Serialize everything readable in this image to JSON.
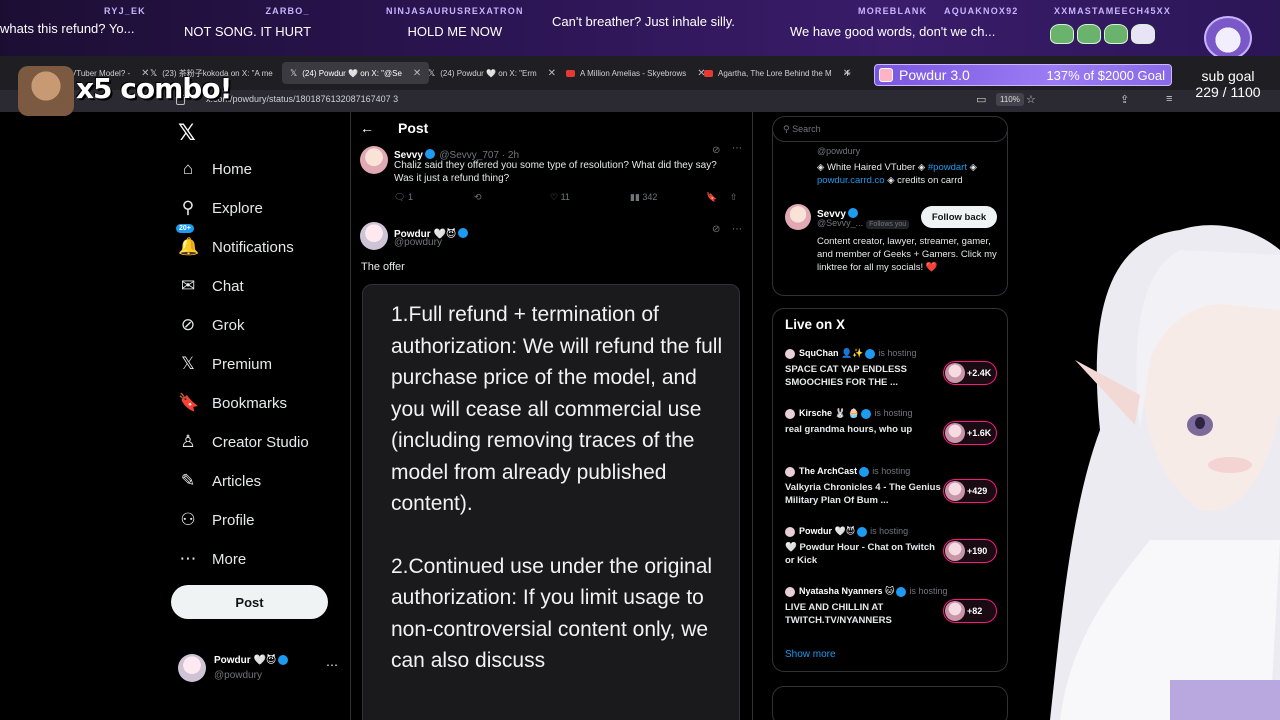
{
  "ticker": [
    {
      "user": "",
      "msg": "whats this refund? Yo..."
    },
    {
      "user": "RYJ_EK",
      "msg": ""
    },
    {
      "user": "ZARBO_",
      "msg": "NOT SONG. IT HURT"
    },
    {
      "user": "NINJASAURUSREXATRON",
      "msg": "HOLD ME NOW"
    },
    {
      "user": "",
      "msg": "Can't breather? Just inhale silly."
    },
    {
      "user": "MOREBLANK",
      "msg": "We have good words, don't we ch..."
    },
    {
      "user": "AQUAKNOX92",
      "msg": ""
    },
    {
      "user": "XXMASTAMEECH45XX",
      "msg": ""
    }
  ],
  "combo": "x5 combo!",
  "donation": {
    "name": "Powdur 3.0",
    "progress": "137% of $2000 Goal",
    "percent": 137
  },
  "subgoal": {
    "title": "sub goal",
    "value": "229 / 1100"
  },
  "browser": {
    "tabs": [
      {
        "label": "My VTuber Model? -"
      },
      {
        "label": "(23) 茶粉子kokoda on X: \"A me"
      },
      {
        "label": "(24) Powdur 🤍 on X: \"@Se"
      },
      {
        "label": "(24) Powdur 🤍 on X: \"Erm"
      },
      {
        "label": "A Million Amelias - Skyebrows"
      },
      {
        "label": "Agartha, The Lore Behind the M"
      }
    ],
    "new_tab": "+",
    "url": "x.com/powdury/status/1801876132087167407 3",
    "zoom": "110%"
  },
  "nav": {
    "items": [
      {
        "label": "Home",
        "icon": "home-icon",
        "glyph": "⌂"
      },
      {
        "label": "Explore",
        "icon": "search-icon",
        "glyph": "⚲"
      },
      {
        "label": "Notifications",
        "icon": "bell-icon",
        "glyph": "🔔",
        "badge": "20+"
      },
      {
        "label": "Chat",
        "icon": "mail-icon",
        "glyph": "✉"
      },
      {
        "label": "Grok",
        "icon": "grok-icon",
        "glyph": "⊘"
      },
      {
        "label": "Premium",
        "icon": "x-premium-icon",
        "glyph": "𝕏"
      },
      {
        "label": "Bookmarks",
        "icon": "bookmark-icon",
        "glyph": "🔖"
      },
      {
        "label": "Creator Studio",
        "icon": "creator-studio-icon",
        "glyph": "♙"
      },
      {
        "label": "Articles",
        "icon": "articles-icon",
        "glyph": "✎"
      },
      {
        "label": "Profile",
        "icon": "profile-icon",
        "glyph": "⚇"
      },
      {
        "label": "More",
        "icon": "more-icon",
        "glyph": "⋯"
      }
    ],
    "post_button": "Post",
    "account": {
      "name": "Powdur 🤍😈",
      "handle": "@powdury"
    }
  },
  "main": {
    "title": "Post",
    "reply": {
      "name": "Sevvy",
      "handle": "@Sevvy_707 · 2h",
      "text": "Chaliz said they offered you some type of resolution? What did they say? Was it just a refund thing?",
      "replies": "1",
      "likes": "11",
      "views": "342"
    },
    "op": {
      "name": "Powdur 🤍😈",
      "handle": "@powdury",
      "text": "The offer"
    },
    "image_text": [
      "1.Full refund + termination of authorization: We will refund the full purchase price of the model, and you will cease all commercial use (including removing traces of the model from     already published content).",
      "2.Continued use under the original authorization: If you limit usage to non-controversial content only, we can also discuss"
    ]
  },
  "right": {
    "search_placeholder": "Search",
    "who": {
      "handle1": "@powdury",
      "bio1_prefix": "◈ White Haired VTuber ◈ ",
      "bio1_tag": "#powdart",
      "bio1_mid": " ◈ ",
      "bio1_link": "powdur.carrd.co",
      "bio1_suffix": " ◈ credits on carrd",
      "name2": "Sevvy",
      "handle2": "@Sevvy_...",
      "follows_you": "Follows you",
      "follow_back": "Follow back",
      "bio2": "Content creator, lawyer, streamer, gamer, and member of Geeks + Gamers. Click my linktree for all my socials! ❤️"
    },
    "live": {
      "title": "Live on X",
      "hosting": "is hosting",
      "rows": [
        {
          "name": "SquChan 👤✨",
          "title": "SPACE CAT YAP ENDLESS SMOOCHIES FOR THE ...",
          "count": "+2.4K"
        },
        {
          "name": "Kirsche 🐰 🧁",
          "title": "real grandma hours, who up",
          "count": "+1.6K"
        },
        {
          "name": "The ArchCast",
          "title": "Valkyria Chronicles 4 - The Genius Military Plan Of Bum ...",
          "count": "+429"
        },
        {
          "name": "Powdur 🤍😈",
          "title": "🤍 Powdur Hour - Chat on Twitch or Kick",
          "count": "+190"
        },
        {
          "name": "Nyatasha Nyanners 🐱",
          "title": "LIVE AND CHILLIN AT TWITCH.TV/NYANNERS",
          "count": "+82"
        }
      ],
      "show_more": "Show more"
    }
  },
  "colors": {
    "accent": "#1d9bf0",
    "live_pink": "#f91880",
    "bg": "#000000",
    "overlay_purple": "#2a1450"
  }
}
